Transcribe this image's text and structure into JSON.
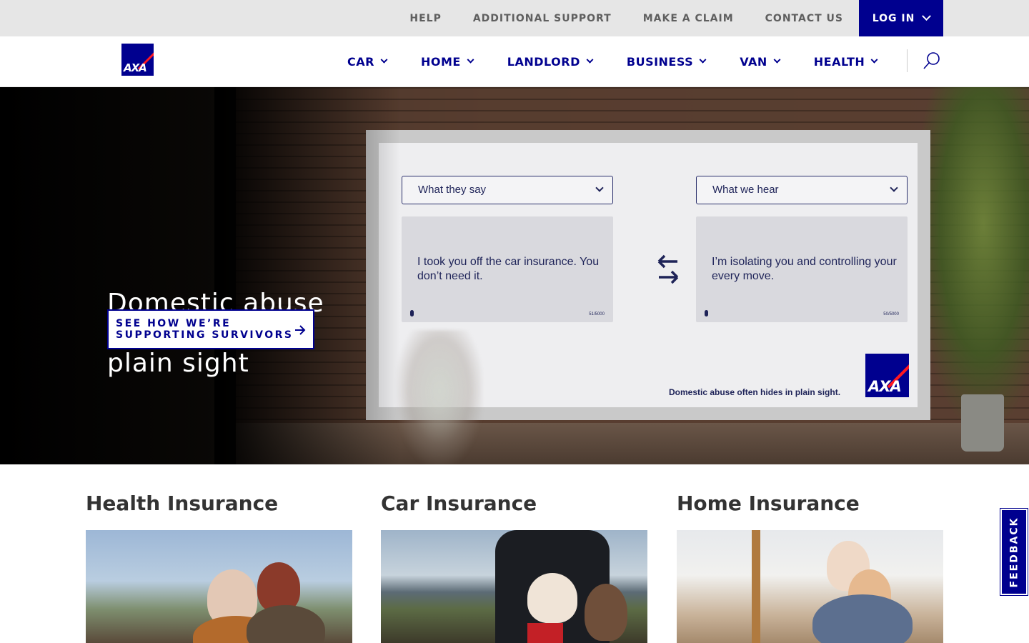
{
  "utility_nav": {
    "links": [
      "HELP",
      "ADDITIONAL SUPPORT",
      "MAKE A CLAIM",
      "CONTACT US"
    ],
    "login_label": "LOG IN"
  },
  "brand": {
    "logo_text": "AXA",
    "brand_color": "#00008f",
    "accent_color": "#ff1721"
  },
  "main_nav": {
    "items": [
      "CAR",
      "HOME",
      "LANDLORD",
      "BUSINESS",
      "VAN",
      "HEALTH"
    ]
  },
  "hero": {
    "title": "Domestic abuse often hides in plain sight",
    "cta_label": "SEE HOW WE’RE SUPPORTING SURVIVORS",
    "billboard": {
      "left_dropdown": "What they say",
      "right_dropdown": "What we hear",
      "left_text": "I took you off the car insurance. You don’t need it.",
      "right_text": "I’m isolating you and controlling your every move.",
      "left_count": "51/5000",
      "right_count": "50/5000",
      "tagline": "Domestic abuse often hides in plain sight.",
      "logo_text": "AXA"
    }
  },
  "cards": [
    {
      "title": "Health Insurance"
    },
    {
      "title": "Car Insurance"
    },
    {
      "title": "Home Insurance"
    }
  ],
  "feedback_label": "FEEDBACK",
  "icons": {
    "search": "search-icon",
    "arrow": "arrow-right-icon",
    "chevron": "chevron-down-icon"
  }
}
